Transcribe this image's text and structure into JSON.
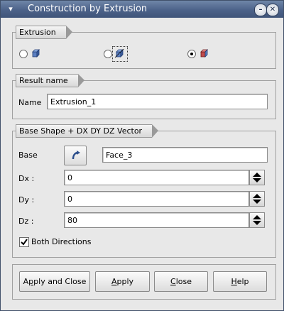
{
  "window": {
    "title": "Construction by Extrusion"
  },
  "extrusion": {
    "tab": "Extrusion",
    "selected_option": 3
  },
  "result": {
    "tab": "Result name",
    "label": "Name",
    "value": "Extrusion_1"
  },
  "base_shape": {
    "tab": "Base Shape + DX DY DZ Vector",
    "base_label": "Base",
    "base_value": "Face_3",
    "dx_label": "Dx :",
    "dx_value": "0",
    "dy_label": "Dy :",
    "dy_value": "0",
    "dz_label": "Dz :",
    "dz_value": "80",
    "both_directions_label": "Both Directions",
    "both_directions_checked": true
  },
  "buttons": {
    "apply_close": {
      "pre": "A",
      "u": "p",
      "post": "ply and Close"
    },
    "apply": {
      "pre": "",
      "u": "A",
      "post": "pply"
    },
    "close": {
      "pre": "",
      "u": "C",
      "post": "lose"
    },
    "help": {
      "pre": "",
      "u": "H",
      "post": "elp"
    }
  },
  "icons": {
    "window_menu": "window-menu-icon",
    "minimize": "minimize-icon",
    "close": "close-icon",
    "selection": "selection-arrow-icon"
  }
}
